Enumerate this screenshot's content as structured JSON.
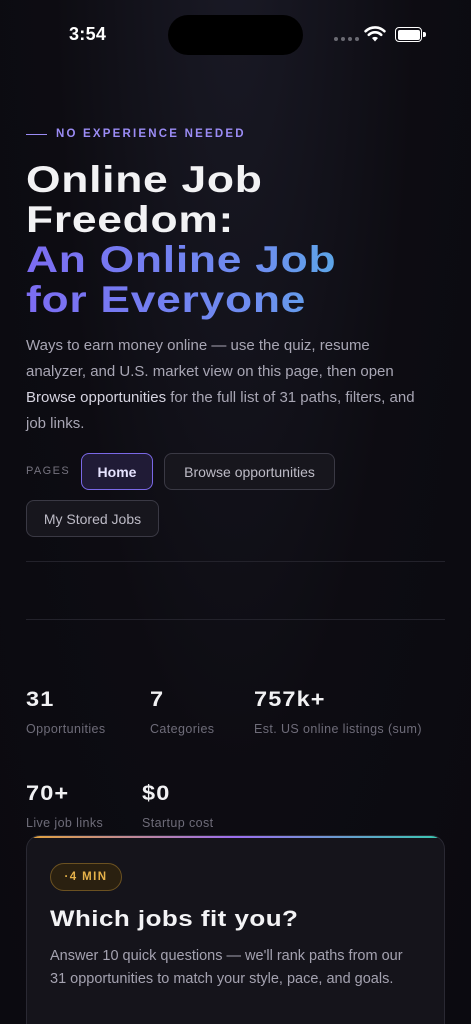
{
  "status_bar": {
    "time": "3:54"
  },
  "hero": {
    "eyebrow": "NO EXPERIENCE NEEDED",
    "title_line1": "Online Job",
    "title_line2": "Freedom:",
    "title_line3": "An Online Job",
    "title_line4": "for Everyone",
    "desc_part1": "Ways to earn money online — use the quiz, resume analyzer, and U.S. market view on this page, then open ",
    "desc_highlight": "Browse opportunities",
    "desc_part2": " for the full list of 31 paths, filters, and job links."
  },
  "pages_nav": {
    "label": "PAGES",
    "items": [
      {
        "label": "Home",
        "active": true
      },
      {
        "label": "Browse opportunities",
        "active": false
      },
      {
        "label": "My Stored Jobs",
        "active": false
      }
    ]
  },
  "stats": [
    {
      "value": "31",
      "label": "Opportunities"
    },
    {
      "value": "7",
      "label": "Categories"
    },
    {
      "value": "757k+",
      "label": "Est. US online listings (sum)"
    },
    {
      "value": "70+",
      "label": "Live job links"
    },
    {
      "value": "$0",
      "label": "Startup cost"
    }
  ],
  "quiz_card": {
    "badge": "·4 MIN",
    "title": "Which jobs fit you?",
    "description": "Answer 10 quick questions — we'll rank paths from our 31 opportunities to match your style, pace, and goals."
  },
  "colors": {
    "accent": "#9b8cf5",
    "gradient_start": "#7c6cf2",
    "gradient_end": "#37c7b4",
    "badge": "#e6b24a",
    "background": "#0d0c12"
  }
}
